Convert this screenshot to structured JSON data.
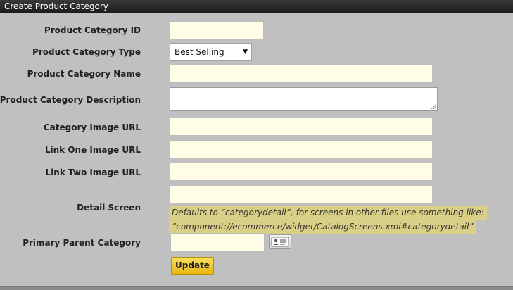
{
  "window": {
    "title": "Create Product Category"
  },
  "form": {
    "fields": {
      "category_id": {
        "label": "Product Category ID",
        "value": ""
      },
      "category_type": {
        "label": "Product Category Type",
        "selected": "Best Selling"
      },
      "category_name": {
        "label": "Product Category Name",
        "value": ""
      },
      "category_description": {
        "label": "Product Category Description",
        "value": ""
      },
      "category_image_url": {
        "label": "Category Image URL",
        "value": ""
      },
      "link_one_image_url": {
        "label": "Link One Image URL",
        "value": ""
      },
      "link_two_image_url": {
        "label": "Link Two Image URL",
        "value": ""
      },
      "detail_screen": {
        "label": "Detail Screen",
        "value": "",
        "hint_line1": "Defaults to “categorydetail”, for screens in other files use something like:",
        "hint_line2": "“component://ecommerce/widget/CatalogScreens.xml#categorydetail”"
      },
      "primary_parent_category": {
        "label": "Primary Parent Category",
        "value": ""
      }
    },
    "update_label": "Update"
  },
  "icons": {
    "select_arrow": "dropdown-arrow-icon",
    "lookup": "lookup-card-icon"
  },
  "colors": {
    "background": "#c0c0c0",
    "header_bar": "#2a2a2a",
    "input_fill": "#fffde6",
    "hint_highlight": "#d9cf86",
    "update_button": "#f0c830"
  }
}
